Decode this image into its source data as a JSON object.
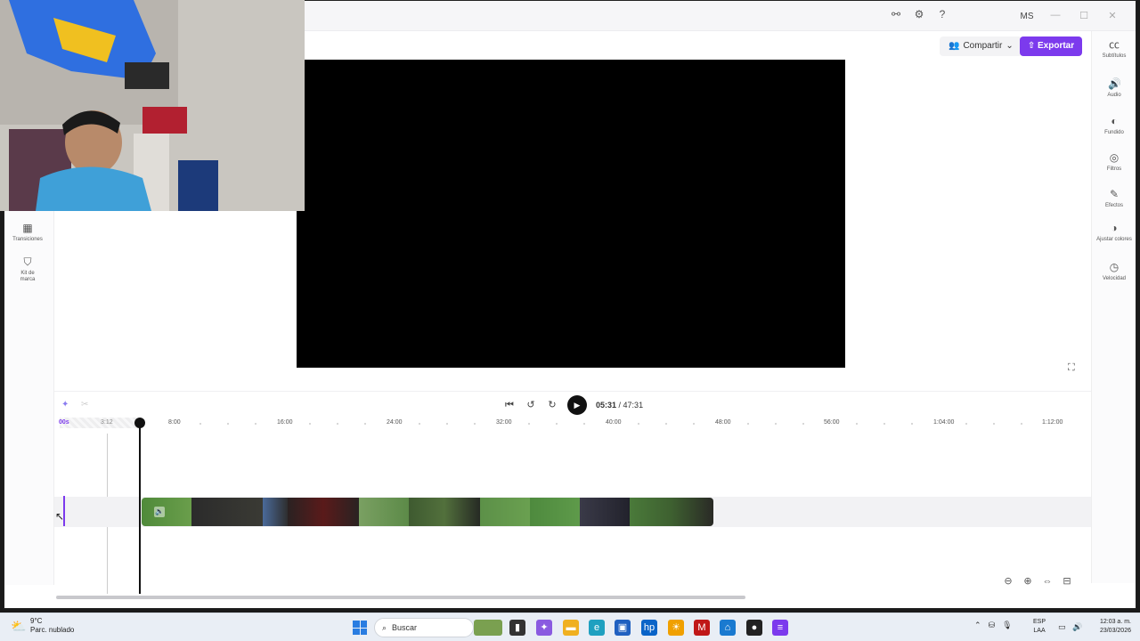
{
  "titlebar": {
    "avatar_initials": "MS",
    "icons": [
      "share-link-icon",
      "gear-icon",
      "help-icon"
    ],
    "window_controls": [
      "minimize-icon",
      "maximize-icon",
      "close-icon"
    ]
  },
  "header": {
    "share_label": "Compartir",
    "export_label": "Exportar",
    "accent_color": "#7c3aed"
  },
  "right_panel": {
    "items": [
      {
        "label": "Subtítulos",
        "icon": "captions-icon"
      },
      {
        "label": "Audio",
        "icon": "speaker-icon"
      },
      {
        "label": "Fundido",
        "icon": "fade-icon"
      },
      {
        "label": "Filtros",
        "icon": "filters-icon"
      },
      {
        "label": "Efectos",
        "icon": "effects-icon"
      },
      {
        "label": "Ajustar colores",
        "icon": "color-adjust-icon"
      },
      {
        "label": "Velocidad",
        "icon": "speed-icon"
      }
    ]
  },
  "left_panel": {
    "items": [
      {
        "label": "Transiciones",
        "icon": "transitions-icon"
      },
      {
        "label": "Kit de marca",
        "icon": "brand-kit-icon"
      }
    ]
  },
  "player": {
    "current_time": "05:31",
    "total_time": "47:31"
  },
  "timeline": {
    "ticks": [
      "00s",
      "3:12",
      "8:00",
      "16:00",
      "24:00",
      "32:00",
      "40:00",
      "48:00",
      "56:00",
      "1:04:00",
      "1:12:00"
    ]
  },
  "taskbar": {
    "weather_temp": "9°C",
    "weather_desc": "Parc. nublado",
    "search_placeholder": "Buscar",
    "lang_top": "ESP",
    "lang_bottom": "LAA",
    "time": "12:03 a. m.",
    "date": "23/03/2026"
  }
}
